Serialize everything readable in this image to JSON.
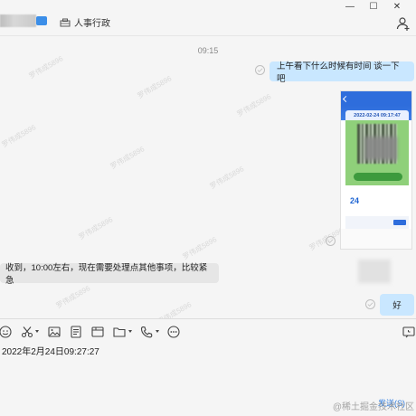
{
  "header": {
    "department": "人事行政",
    "window_controls": [
      "—",
      "☐",
      "✕"
    ]
  },
  "chat": {
    "time_separator": "09:15",
    "watermark": "罗伟成5896",
    "messages": [
      {
        "side": "right",
        "text": "上午看下什么时候有时间  谈一下吧"
      },
      {
        "side": "right",
        "type": "image"
      },
      {
        "side": "left",
        "text": "收到，10:00左右，现在需要处理点其他事项，比较紧急"
      },
      {
        "side": "right",
        "text": "好"
      }
    ],
    "image_preview": {
      "date_text": "2022-02-24 09:17:47",
      "big_number": "24"
    }
  },
  "toolbar": {
    "icons": [
      "emoji-icon",
      "scissors-icon",
      "image-icon",
      "document-icon",
      "folder-icon",
      "phone-icon",
      "more-icon",
      "history-icon"
    ]
  },
  "input": {
    "text": "2022年2月24日09:27:27",
    "send_label": "发送(S)"
  },
  "site_watermark": "@稀土掘金技术社区"
}
